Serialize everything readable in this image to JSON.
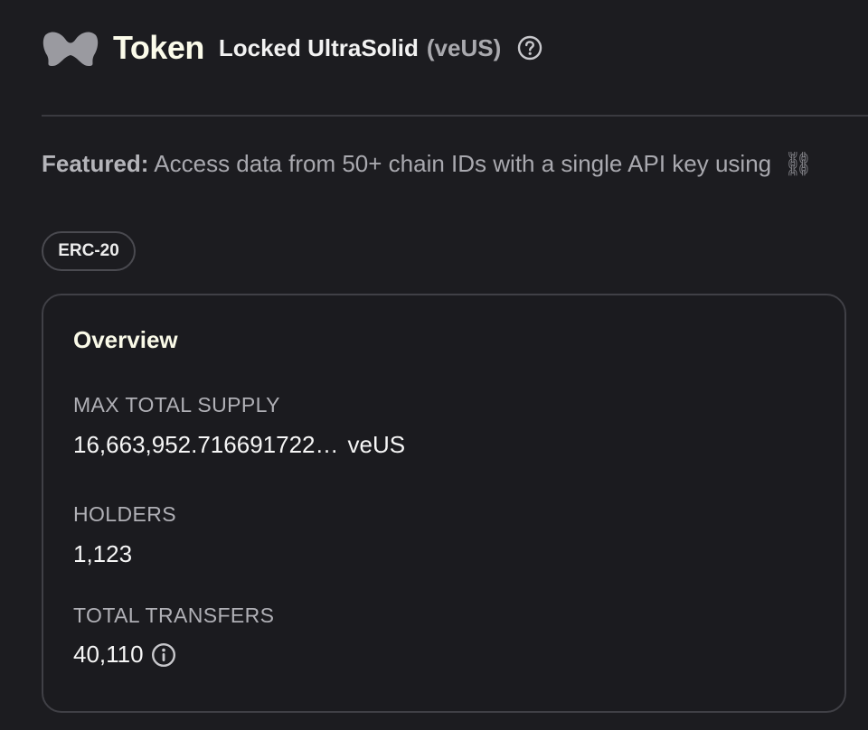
{
  "header": {
    "page_type": "Token",
    "token_name": "Locked UltraSolid",
    "token_symbol": "(veUS)"
  },
  "featured": {
    "label": "Featured:",
    "text": "Access data from 50+ chain IDs with a single API key using"
  },
  "badge": {
    "label": "ERC-20"
  },
  "overview": {
    "title": "Overview",
    "max_total_supply": {
      "label": "MAX TOTAL SUPPLY",
      "value": "16,663,952.716691722…",
      "unit": "veUS"
    },
    "holders": {
      "label": "HOLDERS",
      "value": "1,123"
    },
    "total_transfers": {
      "label": "TOTAL TRANSFERS",
      "value": "40,110"
    }
  },
  "icons": {
    "logo": "token-logo-icon",
    "help": "question-circle-icon",
    "chain": "chain-link-icon",
    "info": "info-circle-icon"
  },
  "colors": {
    "background": "#1c1c20",
    "card_border": "#404046",
    "text_primary": "#f6f6f6",
    "text_muted": "#b0b0b6"
  }
}
